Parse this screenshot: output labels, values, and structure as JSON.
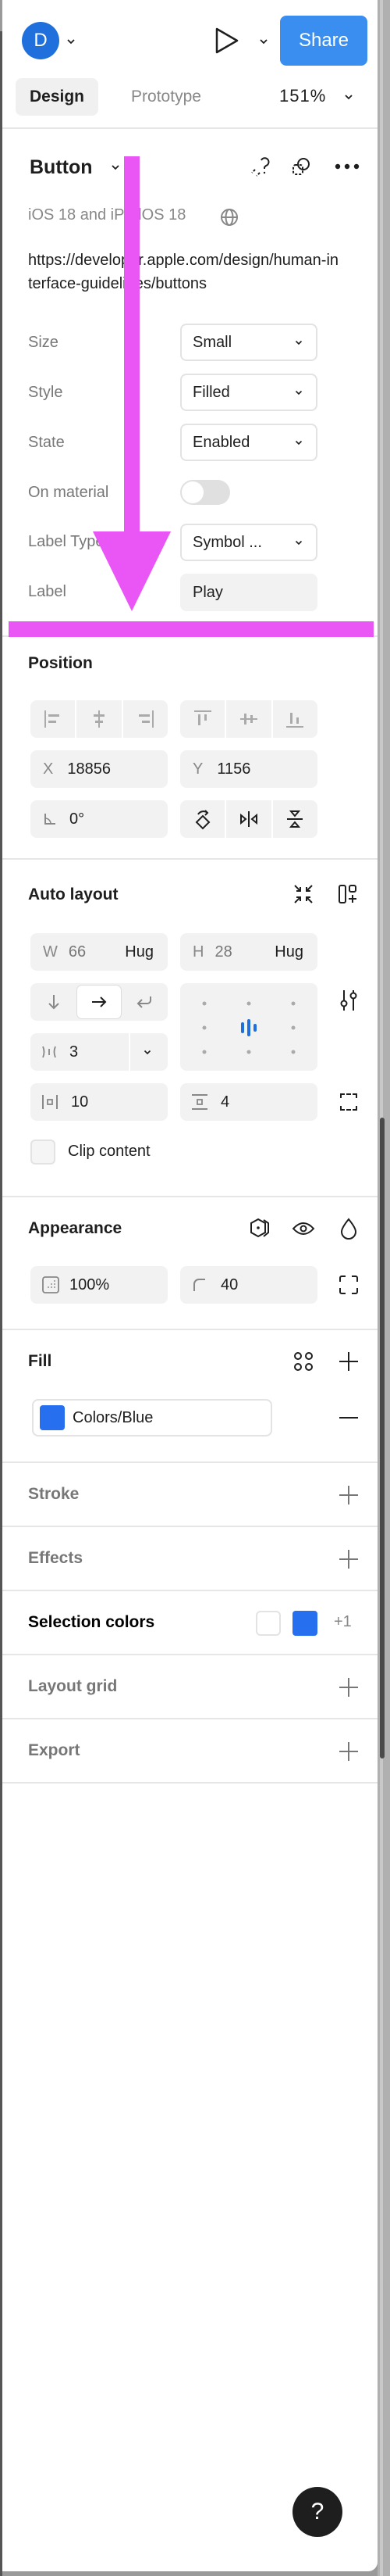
{
  "header": {
    "avatar_initial": "D",
    "share_label": "Share",
    "tabs": [
      {
        "label": "Design",
        "active": true
      },
      {
        "label": "Prototype",
        "active": false
      }
    ],
    "zoom_level": "151%"
  },
  "component": {
    "name": "Button",
    "source": "iOS 18 and iPadOS 18",
    "url": "https://developer.apple.com/design/human-interface-guidelines/buttons",
    "properties": [
      {
        "label": "Size",
        "type": "dropdown",
        "value": "Small"
      },
      {
        "label": "Style",
        "type": "dropdown",
        "value": "Filled"
      },
      {
        "label": "State",
        "type": "dropdown",
        "value": "Enabled"
      },
      {
        "label": "On material",
        "type": "toggle",
        "value": false
      },
      {
        "label": "Label Type",
        "type": "dropdown",
        "value": "Symbol ..."
      },
      {
        "label": "Label",
        "type": "text",
        "value": "Play"
      }
    ]
  },
  "position": {
    "title": "Position",
    "x_label": "X",
    "x_value": "18856",
    "y_label": "Y",
    "y_value": "1156",
    "rotation_value": "0°"
  },
  "auto_layout": {
    "title": "Auto layout",
    "w_label": "W",
    "w_value": "66",
    "w_mode": "Hug",
    "h_label": "H",
    "h_value": "28",
    "h_mode": "Hug",
    "gap_value": "3",
    "h_padding": "10",
    "v_padding": "4",
    "clip_content_label": "Clip content",
    "clip_content": false
  },
  "appearance": {
    "title": "Appearance",
    "opacity": "100%",
    "corner_radius": "40"
  },
  "fill": {
    "title": "Fill",
    "style_name": "Colors/Blue",
    "color": "#2670f0"
  },
  "sections": {
    "stroke": "Stroke",
    "effects": "Effects",
    "selection_colors": "Selection colors",
    "selection_more": "+1",
    "layout_grid": "Layout grid",
    "export": "Export"
  },
  "colors": {
    "accent": "#3a8ef0",
    "annotation": "#ea55f5",
    "avatar": "#1f6fdc"
  },
  "help_label": "?"
}
